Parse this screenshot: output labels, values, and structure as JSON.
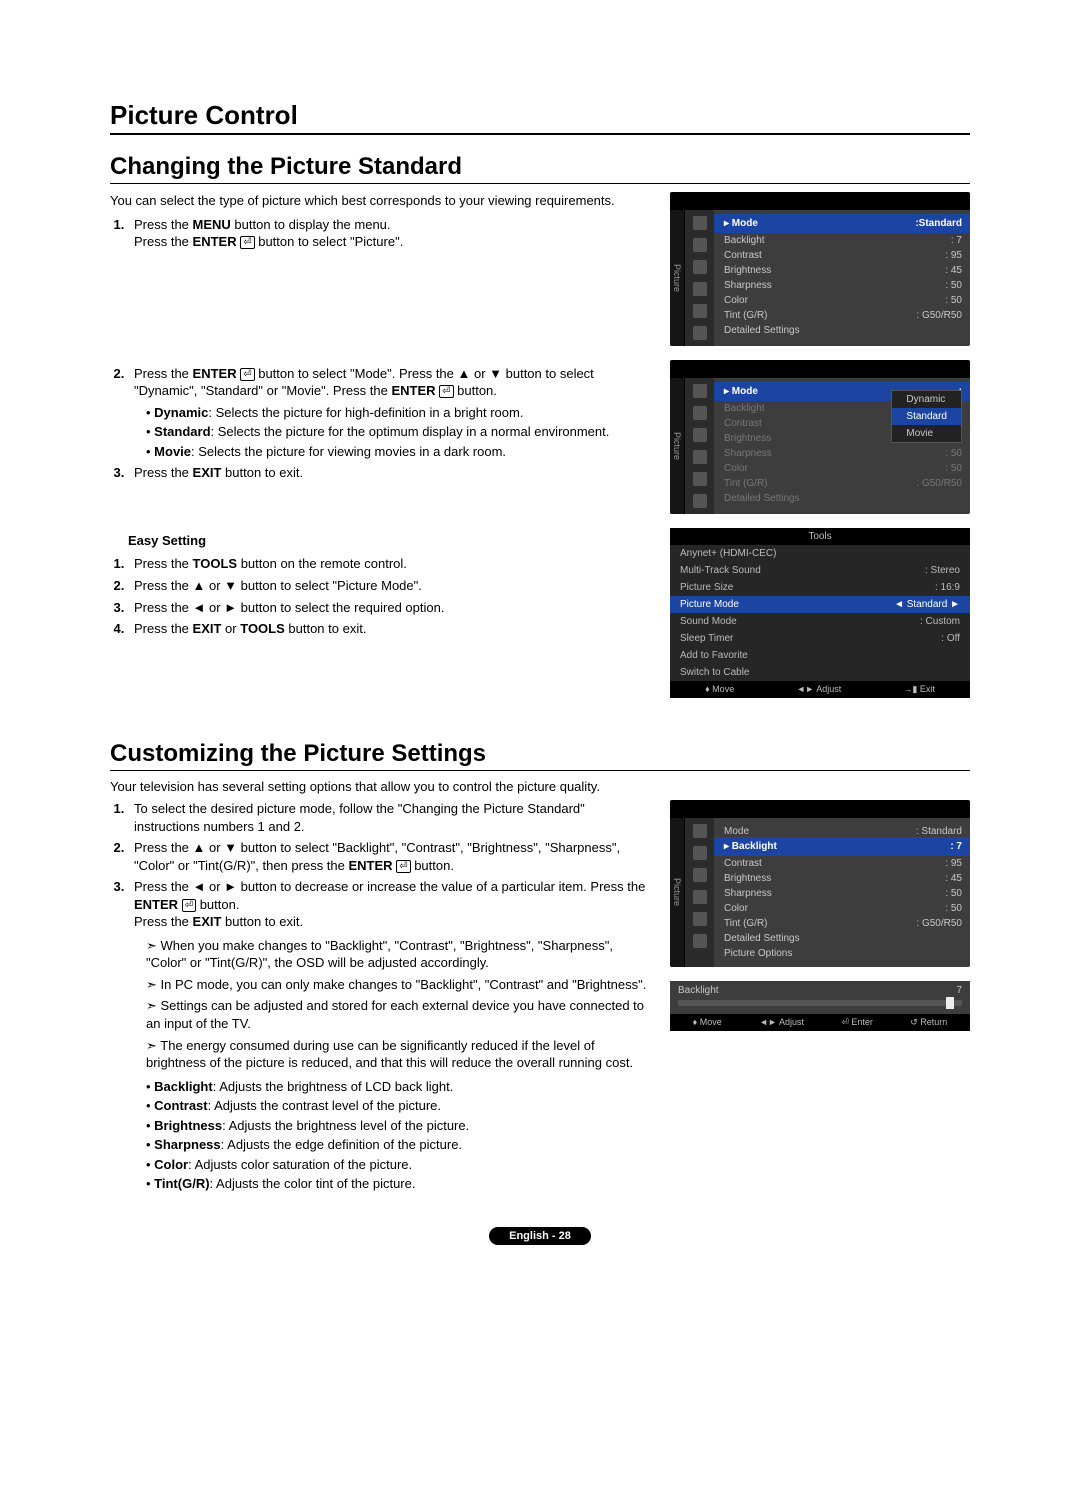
{
  "pageTitle": "Picture Control",
  "section1": {
    "title": "Changing the Picture Standard",
    "intro": "You can select the type of picture which best corresponds to your viewing requirements.",
    "step1a": "Press the ",
    "step1b": " button to display the menu.",
    "step1c": "Press the ",
    "step1d": " button to select \"Picture\".",
    "menuWord": "MENU",
    "enterWord": "ENTER",
    "step2a": "Press the ",
    "step2b": " button to select \"Mode\". Press the ▲ or ▼ button to select \"Dynamic\", \"Standard\" or \"Movie\". Press the ",
    "step2c": " button.",
    "modeDyn": "Dynamic",
    "modeDynDesc": ": Selects the picture for high-definition in a bright room.",
    "modeStd": "Standard",
    "modeStdDesc": ": Selects the picture for the optimum display in a normal environment.",
    "modeMov": "Movie",
    "modeMovDesc": ": Selects the picture for viewing movies in a dark room.",
    "step3a": "Press the ",
    "step3b": " button to exit.",
    "exitWord": "EXIT",
    "easyTitle": "Easy Setting",
    "easy1a": "Press the ",
    "easy1b": " button on the remote control.",
    "toolsWord": "TOOLS",
    "easy2": "Press the ▲ or ▼ button to select \"Picture Mode\".",
    "easy3": "Press the ◄ or ► button to select the required option.",
    "easy4a": "Press the ",
    "easy4b": " or ",
    "easy4c": " button to exit."
  },
  "section2": {
    "title": "Customizing the Picture Settings",
    "intro": "Your television has several setting options that allow you to control the picture quality.",
    "step1": "To select the desired picture mode, follow the \"Changing the Picture Standard\" instructions numbers 1 and 2.",
    "step2a": "Press the ▲ or ▼ button to select \"Backlight\", \"Contrast\", \"Brightness\", \"Sharpness\", \"Color\" or \"Tint(G/R)\", then press the ",
    "step2b": " button.",
    "step3a": "Press the ◄ or ► button to decrease or increase the value of a particular item. Press the ",
    "step3b": " button.",
    "step3c": "Press the ",
    "step3d": " button to exit.",
    "note1": "When you make changes to \"Backlight\", \"Contrast\", \"Brightness\", \"Sharpness\", \"Color\" or \"Tint(G/R)\", the OSD will be adjusted accordingly.",
    "note2": "In PC mode, you can only make changes to \"Backlight\", \"Contrast\" and \"Brightness\".",
    "note3": "Settings can be adjusted and stored for each external device you have connected to an input of the TV.",
    "note4": "The energy consumed during use can be significantly reduced if the level of brightness of the picture is reduced, and that this will reduce the overall running cost.",
    "defBack": "Backlight",
    "defBackD": ": Adjusts the brightness of LCD back light.",
    "defCont": "Contrast",
    "defContD": ": Adjusts the contrast level of the picture.",
    "defBri": "Brightness",
    "defBriD": ": Adjusts the brightness level of the picture.",
    "defSharp": "Sharpness",
    "defSharpD": ": Adjusts the edge definition of the picture.",
    "defCol": "Color",
    "defColD": ": Adjusts color saturation of the picture.",
    "defTint": "Tint(G/R)",
    "defTintD": ": Adjusts the color tint of the picture."
  },
  "osd1": {
    "tab": "Picture",
    "items": [
      {
        "l": "Mode",
        "v": ":Standard",
        "hl": true
      },
      {
        "l": "Backlight",
        "v": ": 7"
      },
      {
        "l": "Contrast",
        "v": ": 95"
      },
      {
        "l": "Brightness",
        "v": ": 45"
      },
      {
        "l": "Sharpness",
        "v": ": 50"
      },
      {
        "l": "Color",
        "v": ": 50"
      },
      {
        "l": "Tint (G/R)",
        "v": ": G50/R50"
      },
      {
        "l": "Detailed Settings",
        "v": ""
      }
    ]
  },
  "osd2": {
    "tab": "Picture",
    "items": [
      {
        "l": "Mode",
        "v": ":",
        "hl": true
      },
      {
        "l": "Backlight",
        "v": "",
        "dim": true
      },
      {
        "l": "Contrast",
        "v": "",
        "dim": true
      },
      {
        "l": "Brightness",
        "v": "",
        "dim": true
      },
      {
        "l": "Sharpness",
        "v": ": 50",
        "dim": true
      },
      {
        "l": "Color",
        "v": ": 50",
        "dim": true
      },
      {
        "l": "Tint (G/R)",
        "v": ": G50/R50",
        "dim": true
      },
      {
        "l": "Detailed Settings",
        "v": "",
        "dim": true
      }
    ],
    "dropdown": [
      "Dynamic",
      "Standard",
      "Movie"
    ],
    "dropdownSel": 1
  },
  "tools": {
    "title": "Tools",
    "rows": [
      {
        "l": "Anynet+ (HDMI-CEC)",
        "v": ""
      },
      {
        "l": "Multi-Track Sound",
        "v": "Stereo",
        "sep": ":"
      },
      {
        "l": "Picture Size",
        "v": "16:9",
        "sep": ":"
      },
      {
        "l": "Picture Mode",
        "v": "Standard",
        "sel": true,
        "arrows": true
      },
      {
        "l": "Sound Mode",
        "v": "Custom",
        "sep": ":"
      },
      {
        "l": "Sleep Timer",
        "v": "Off",
        "sep": ":"
      },
      {
        "l": "Add to Favorite",
        "v": ""
      },
      {
        "l": "Switch to Cable",
        "v": ""
      }
    ],
    "foot": [
      "♦ Move",
      "◄► Adjust",
      "→▮ Exit"
    ]
  },
  "osd3": {
    "tab": "Picture",
    "items": [
      {
        "l": "Mode",
        "v": ": Standard"
      },
      {
        "l": "Backlight",
        "v": ": 7",
        "hl": true
      },
      {
        "l": "Contrast",
        "v": ": 95"
      },
      {
        "l": "Brightness",
        "v": ": 45"
      },
      {
        "l": "Sharpness",
        "v": ": 50"
      },
      {
        "l": "Color",
        "v": ": 50"
      },
      {
        "l": "Tint (G/R)",
        "v": ": G50/R50"
      },
      {
        "l": "Detailed Settings",
        "v": ""
      },
      {
        "l": "Picture Options",
        "v": ""
      }
    ]
  },
  "slider": {
    "label": "Backlight",
    "value": "7"
  },
  "sliderFoot": [
    "♦ Move",
    "◄► Adjust",
    "⏎ Enter",
    "↺ Return"
  ],
  "footer": "English - 28"
}
